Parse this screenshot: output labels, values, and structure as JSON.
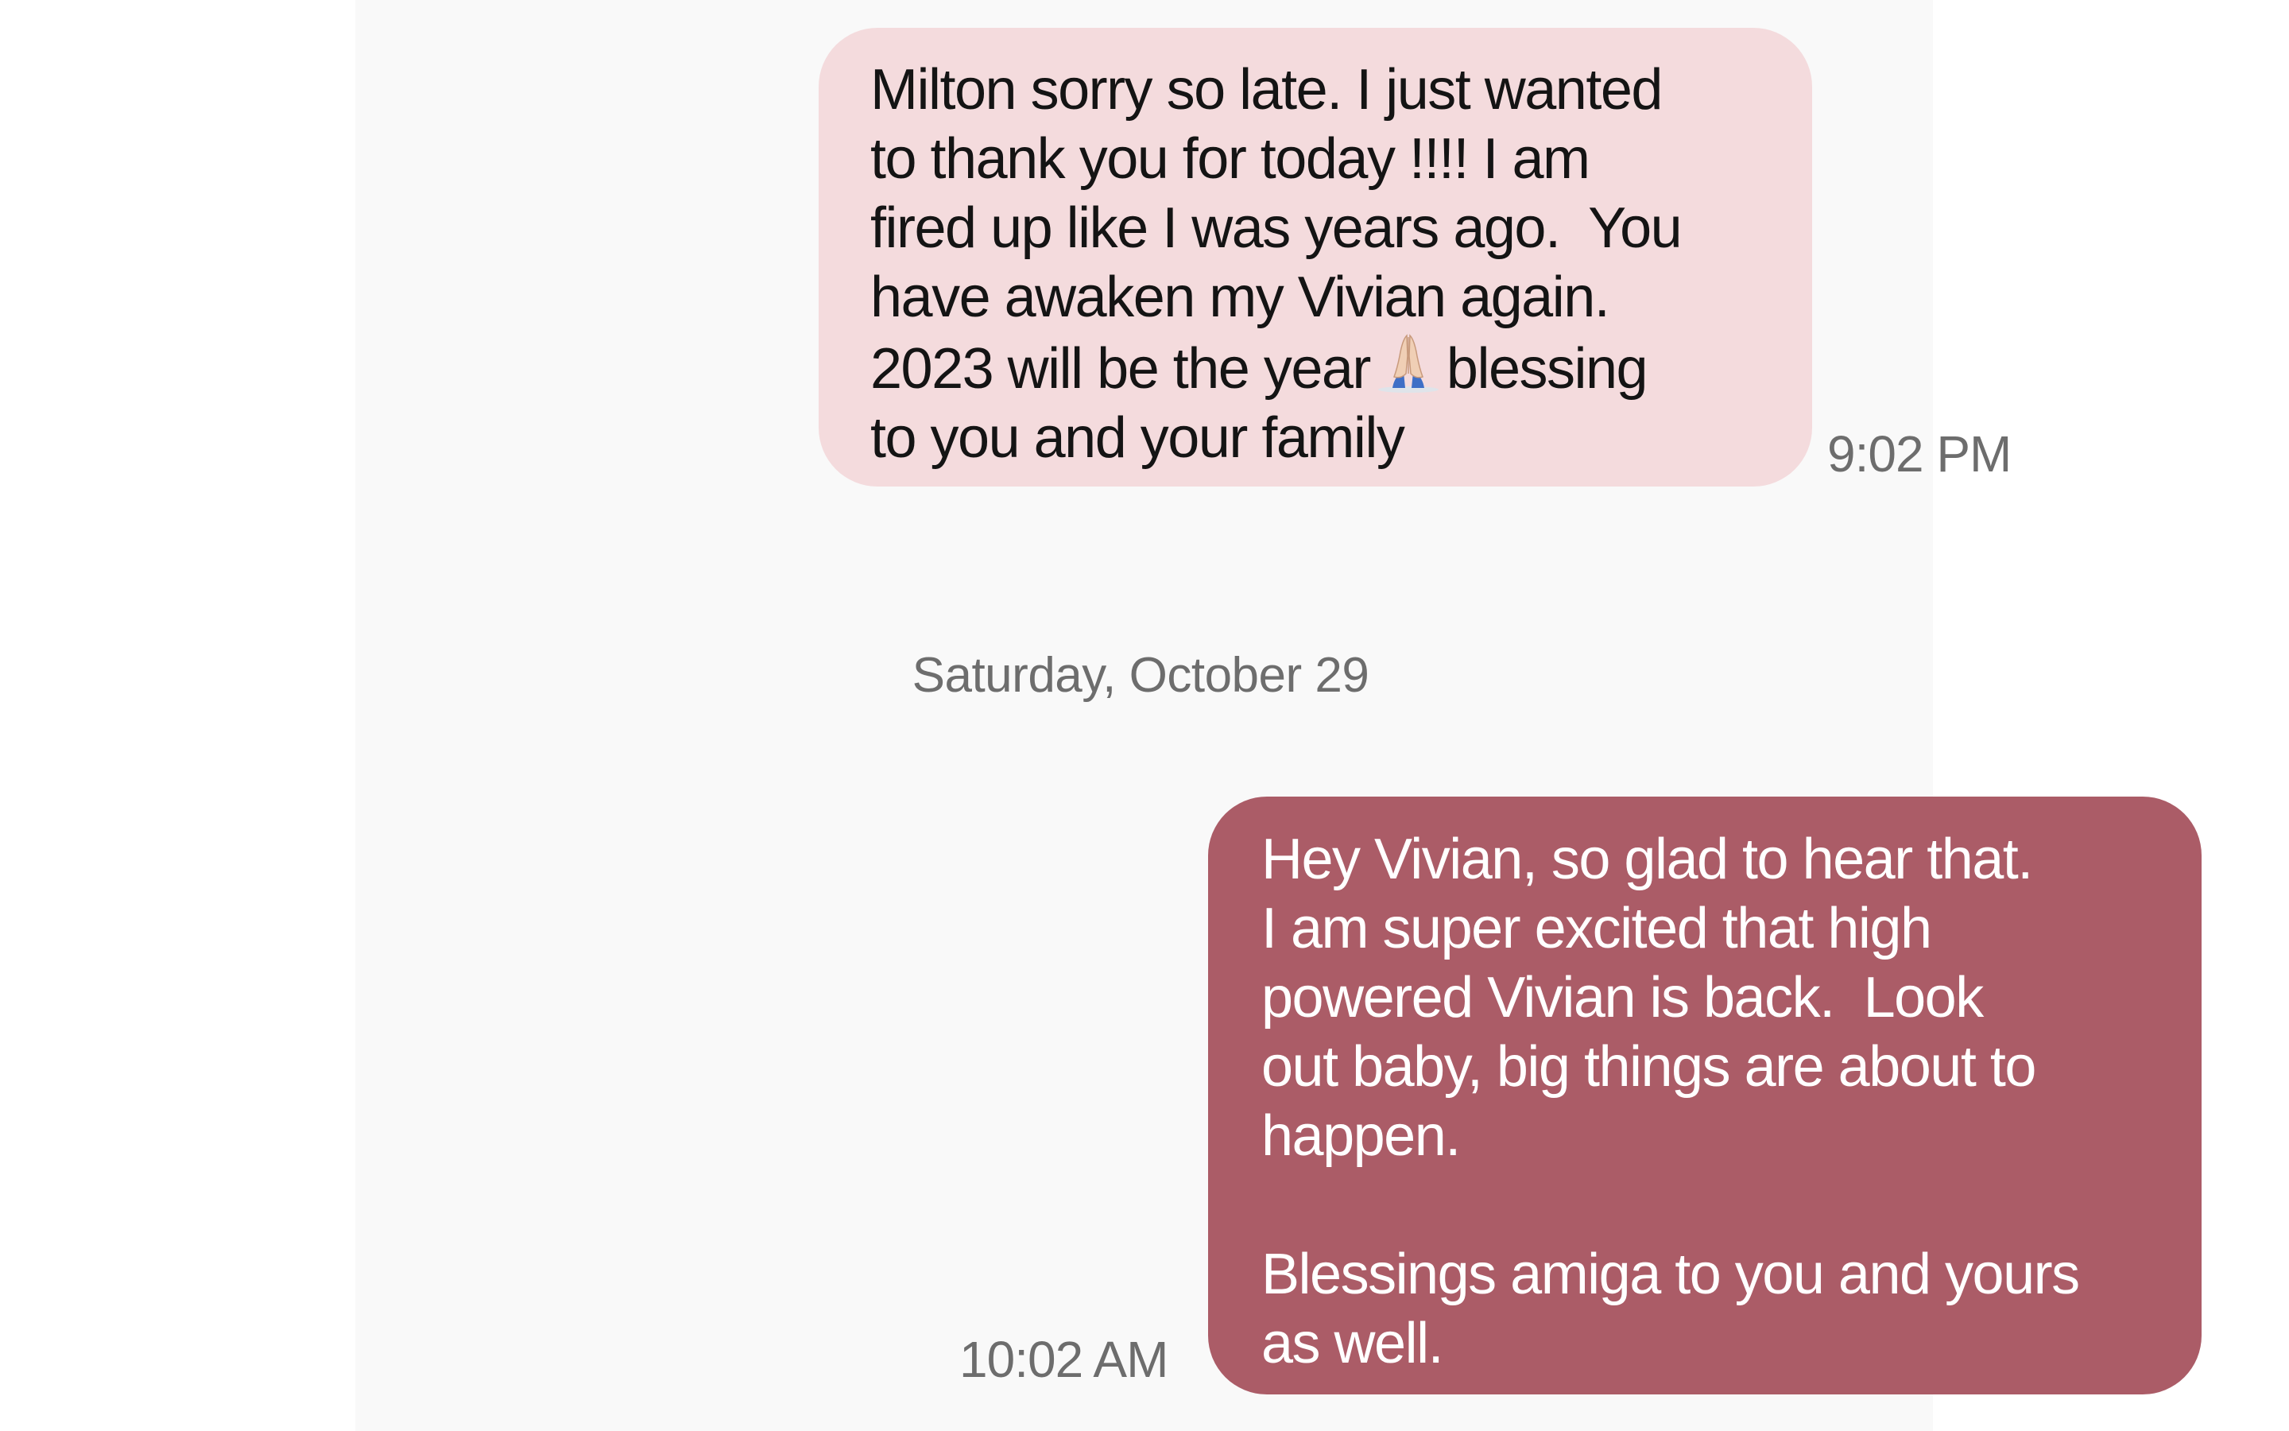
{
  "conversation": {
    "messages": [
      {
        "direction": "incoming",
        "text_before_emoji": "Milton sorry so late. I just wanted\nto thank you for today !!!! I am\nfired up like I was years ago.  You\nhave awaken my Vivian again.\n2023 will be the year",
        "emoji": "folded-hands-emoji",
        "text_after_emoji": "blessing\nto you and your family",
        "time": "9:02 PM"
      },
      {
        "direction": "outgoing",
        "text": "Hey Vivian, so glad to hear that.\nI am super excited that high\npowered Vivian is back.  Look\nout baby, big things are about to\nhappen.\n\nBlessings amiga to you and yours\nas well.",
        "time": "10:02 AM"
      }
    ],
    "date_separator": "Saturday, October 29"
  },
  "colors": {
    "incoming_bubble": "#f4dbdd",
    "outgoing_bubble": "#ab5c67",
    "timestamp_text": "#6d6d6d",
    "background": "#f9f9f9"
  }
}
